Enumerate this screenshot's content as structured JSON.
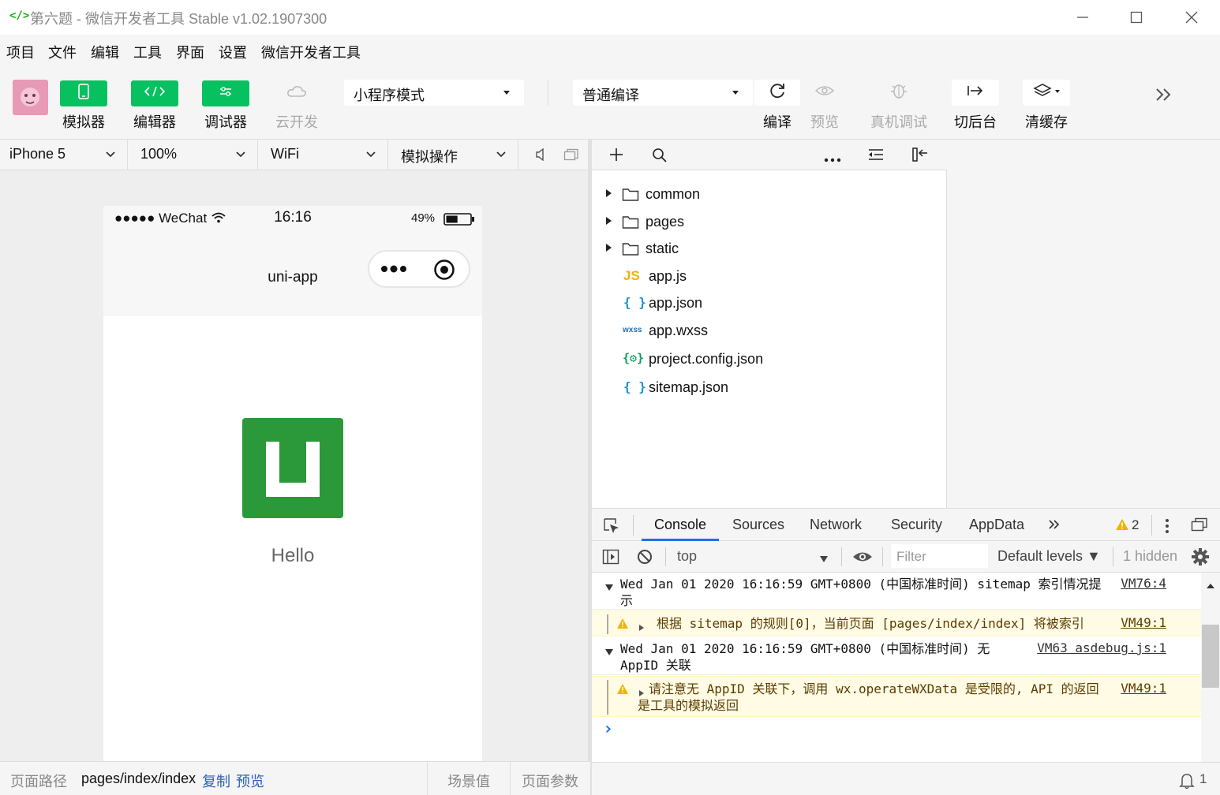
{
  "window": {
    "title": "第六题 - 微信开发者工具 Stable v1.02.1907300",
    "logo_glyph": "</>",
    "controls": [
      "minimize",
      "maximize",
      "close"
    ]
  },
  "menu": [
    "项目",
    "文件",
    "编辑",
    "工具",
    "界面",
    "设置",
    "微信开发者工具"
  ],
  "toolbar": {
    "simulator_label": "模拟器",
    "editor_label": "编辑器",
    "debugger_label": "调试器",
    "cloud_label": "云开发",
    "mode_select": "小程序模式",
    "compile_select": "普通编译",
    "compile_label": "编译",
    "preview_label": "预览",
    "remote_debug_label": "真机调试",
    "background_label": "切后台",
    "clear_cache_label": "清缓存"
  },
  "simbar": {
    "device": "iPhone 5",
    "zoom": "100%",
    "network": "WiFi",
    "operation": "模拟操作"
  },
  "phone": {
    "carrier": "●●●●● WeChat",
    "time": "16:16",
    "battery": "49%",
    "battery_level": 0.49,
    "nav_title": "uni-app",
    "hello_text": "Hello",
    "logo_color": "#2b9939"
  },
  "filetree": {
    "folders": [
      "common",
      "pages",
      "static"
    ],
    "files": [
      {
        "name": "app.js",
        "icon": "js-icon",
        "badge": "JS"
      },
      {
        "name": "app.json",
        "icon": "json-icon",
        "badge": "{ }"
      },
      {
        "name": "app.wxss",
        "icon": "wxss-icon",
        "badge": "wxss"
      },
      {
        "name": "project.config.json",
        "icon": "config-json-icon",
        "badge": "{⚙}"
      },
      {
        "name": "sitemap.json",
        "icon": "json-icon",
        "badge": "{ }"
      }
    ]
  },
  "devtools": {
    "tabs": [
      "Console",
      "Sources",
      "Network",
      "Security",
      "AppData"
    ],
    "active_tab": "Console",
    "warning_count": "2",
    "context": "top",
    "filter_placeholder": "Filter",
    "levels": "Default levels ▼",
    "hidden": "1 hidden"
  },
  "console": {
    "messages": [
      {
        "type": "log",
        "text": "Wed Jan 01 2020 16:16:59 GMT+0800 (中国标准时间) sitemap 索引情况提示",
        "source": "VM76:4"
      },
      {
        "type": "warn",
        "text": "根据 sitemap 的规则[0]，当前页面 [pages/index/index] 将被索引",
        "source": "VM49:1"
      },
      {
        "type": "log",
        "text": "Wed Jan 01 2020 16:16:59 GMT+0800 (中国标准时间) 无 AppID 关联",
        "source": "VM63 asdebug.js:1"
      },
      {
        "type": "warn",
        "text": "请注意无 AppID 关联下，调用 wx.operateWXData 是受限的, API 的返回是工具的模拟返回",
        "source": "VM49:1"
      }
    ],
    "prompt": "›"
  },
  "bottombar": {
    "path_label": "页面路径",
    "path": "pages/index/index",
    "copy": "复制",
    "preview": "预览",
    "scene": "场景值",
    "params": "页面参数",
    "notifications": "1"
  },
  "colors": {
    "accent": "#07c160",
    "link": "#2a62b8",
    "warn": "#f0b400"
  }
}
